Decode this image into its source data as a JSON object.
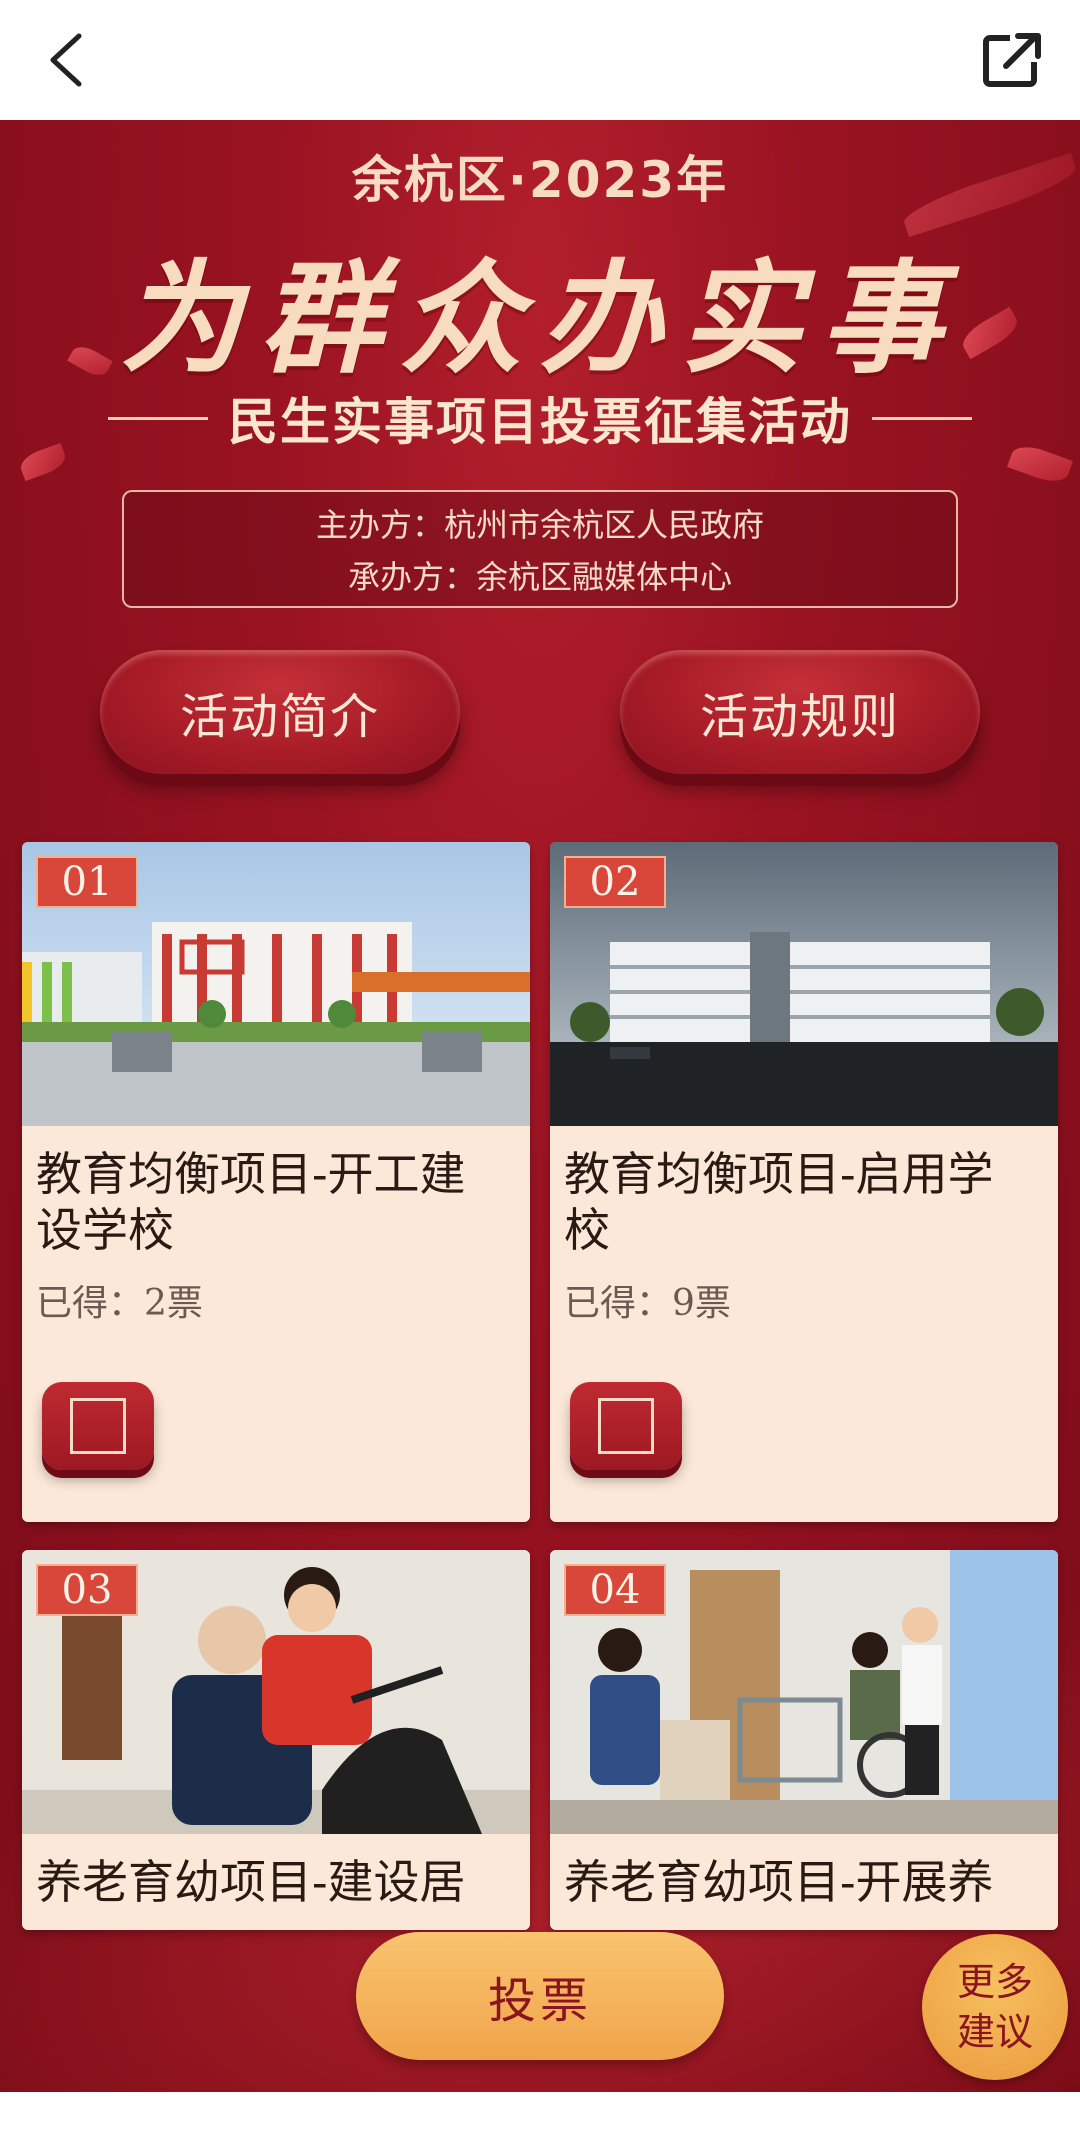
{
  "header": {
    "year": "余杭区·2023年",
    "title": "为群众办实事",
    "subtitle": "民生实事项目投票征集活动",
    "organizer": "主办方：杭州市余杭区人民政府",
    "co_organizer": "承办方：余杭区融媒体中心"
  },
  "buttons": {
    "intro": "活动简介",
    "rules": "活动规则",
    "vote": "投票",
    "more_line1": "更多",
    "more_line2": "建议"
  },
  "icons": {
    "back": "back-arrow-icon",
    "share": "share-external-icon"
  },
  "colors": {
    "background_red": "#9a1322",
    "card_bg": "#fbe8d8",
    "badge": "#d9473a",
    "vote_gold": "#f0a44a"
  },
  "projects": [
    {
      "number": "01",
      "title_line1": "教育均衡项目-开工建",
      "title_line2": "设学校",
      "votes": "已得：2票"
    },
    {
      "number": "02",
      "title_line1": "教育均衡项目-启用学",
      "title_line2": "校",
      "votes": "已得：9票"
    },
    {
      "number": "03",
      "title_line1": "养老育幼项目-建设居",
      "title_line2": "",
      "votes": ""
    },
    {
      "number": "04",
      "title_line1": "养老育幼项目-开展养",
      "title_line2": "",
      "votes": ""
    }
  ]
}
